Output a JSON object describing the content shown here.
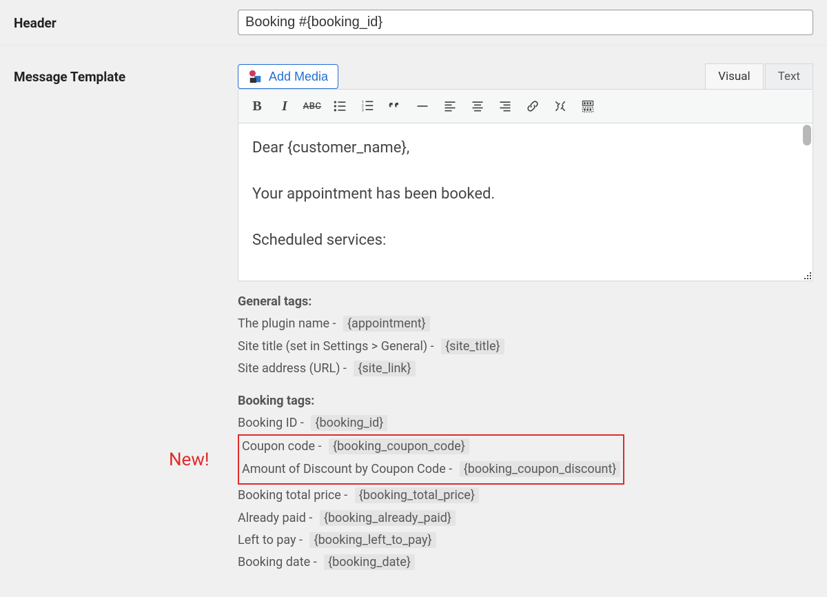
{
  "header": {
    "label": "Header",
    "value": "Booking #{booking_id}"
  },
  "message_template": {
    "label": "Message Template"
  },
  "editor": {
    "add_media_label": "Add Media",
    "tabs": {
      "visual": "Visual",
      "text": "Text"
    },
    "body": {
      "line1": "Dear {customer_name},",
      "line2": "Your appointment has been booked.",
      "line3": "Scheduled services:"
    }
  },
  "tags": {
    "general_heading": "General tags",
    "general": [
      {
        "label": "The plugin name - ",
        "tag": "{appointment}"
      },
      {
        "label": "Site title (set in Settings > General) - ",
        "tag": "{site_title}"
      },
      {
        "label": "Site address (URL) - ",
        "tag": "{site_link}"
      }
    ],
    "booking_heading": "Booking tags",
    "booking_pre": [
      {
        "label": "Booking ID - ",
        "tag": "{booking_id}"
      }
    ],
    "highlight_label": "New!",
    "booking_highlight": [
      {
        "label": "Coupon code - ",
        "tag": "{booking_coupon_code}"
      },
      {
        "label": "Amount of Discount by Coupon Code - ",
        "tag": "{booking_coupon_discount}"
      }
    ],
    "booking_post": [
      {
        "label": "Booking total price - ",
        "tag": "{booking_total_price}"
      },
      {
        "label": "Already paid - ",
        "tag": "{booking_already_paid}"
      },
      {
        "label": "Left to pay - ",
        "tag": "{booking_left_to_pay}"
      },
      {
        "label": "Booking date - ",
        "tag": "{booking_date}"
      }
    ]
  }
}
